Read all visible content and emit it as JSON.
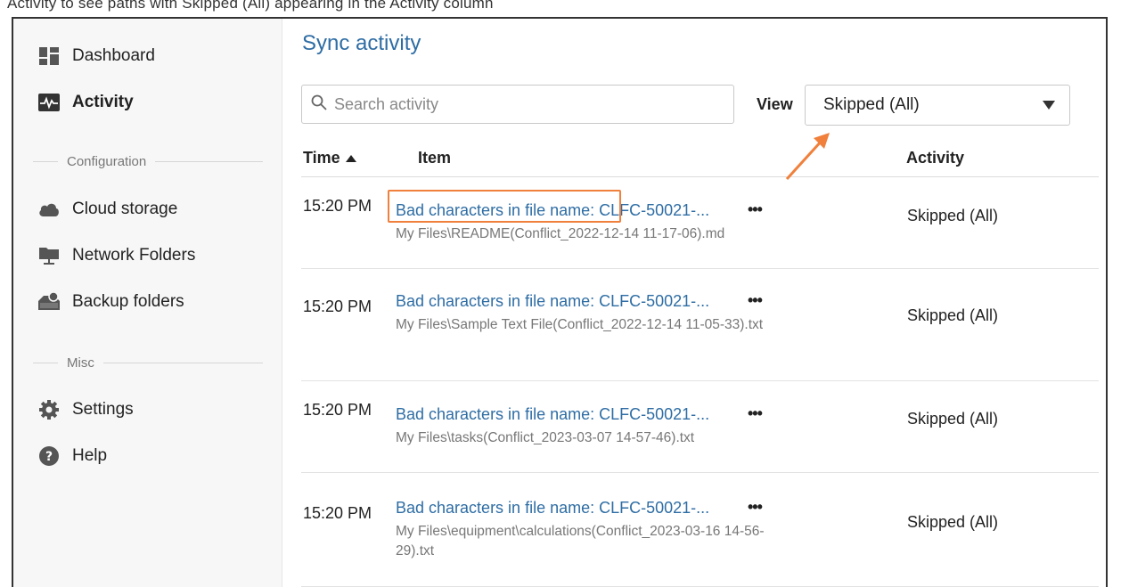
{
  "top_strip_text": "Activity to see paths with Skipped (All) appearing in the Activity column",
  "sidebar": {
    "items_top": [
      {
        "label": "Dashboard",
        "icon": "dashboard-icon"
      },
      {
        "label": "Activity",
        "icon": "activity-icon",
        "active": true
      }
    ],
    "section_configuration": "Configuration",
    "items_config": [
      {
        "label": "Cloud storage",
        "icon": "cloud-icon"
      },
      {
        "label": "Network Folders",
        "icon": "network-folder-icon"
      },
      {
        "label": "Backup folders",
        "icon": "backup-folder-icon"
      }
    ],
    "section_misc": "Misc",
    "items_misc": [
      {
        "label": "Settings",
        "icon": "gear-icon"
      },
      {
        "label": "Help",
        "icon": "help-icon"
      }
    ]
  },
  "main": {
    "title": "Sync activity",
    "search_placeholder": "Search activity",
    "view_label": "View",
    "view_selected": "Skipped (All)",
    "columns": {
      "time": "Time",
      "item": "Item",
      "activity": "Activity"
    },
    "rows": [
      {
        "time": "15:20 PM",
        "item": "Bad characters in file name: CLFC-50021-...",
        "path": "My Files\\README(Conflict_2022-12-14 11-17-06).md",
        "activity": "Skipped (All)"
      },
      {
        "time": "15:20 PM",
        "item": "Bad characters in file name: CLFC-50021-...",
        "path": "My Files\\Sample Text File(Conflict_2022-12-14 11-05-33).txt",
        "activity": "Skipped (All)"
      },
      {
        "time": "15:20 PM",
        "item": "Bad characters in file name: CLFC-50021-...",
        "path": "My Files\\tasks(Conflict_2023-03-07 14-57-46).txt",
        "activity": "Skipped (All)"
      },
      {
        "time": "15:20 PM",
        "item": "Bad characters in file name: CLFC-50021-...",
        "path": "My Files\\equipment\\calculations(Conflict_2023-03-16 14-56-29).txt",
        "activity": "Skipped (All)"
      }
    ],
    "more_glyph": "•••"
  },
  "colors": {
    "link": "#2e6da4",
    "annotation": "#f0803c"
  }
}
